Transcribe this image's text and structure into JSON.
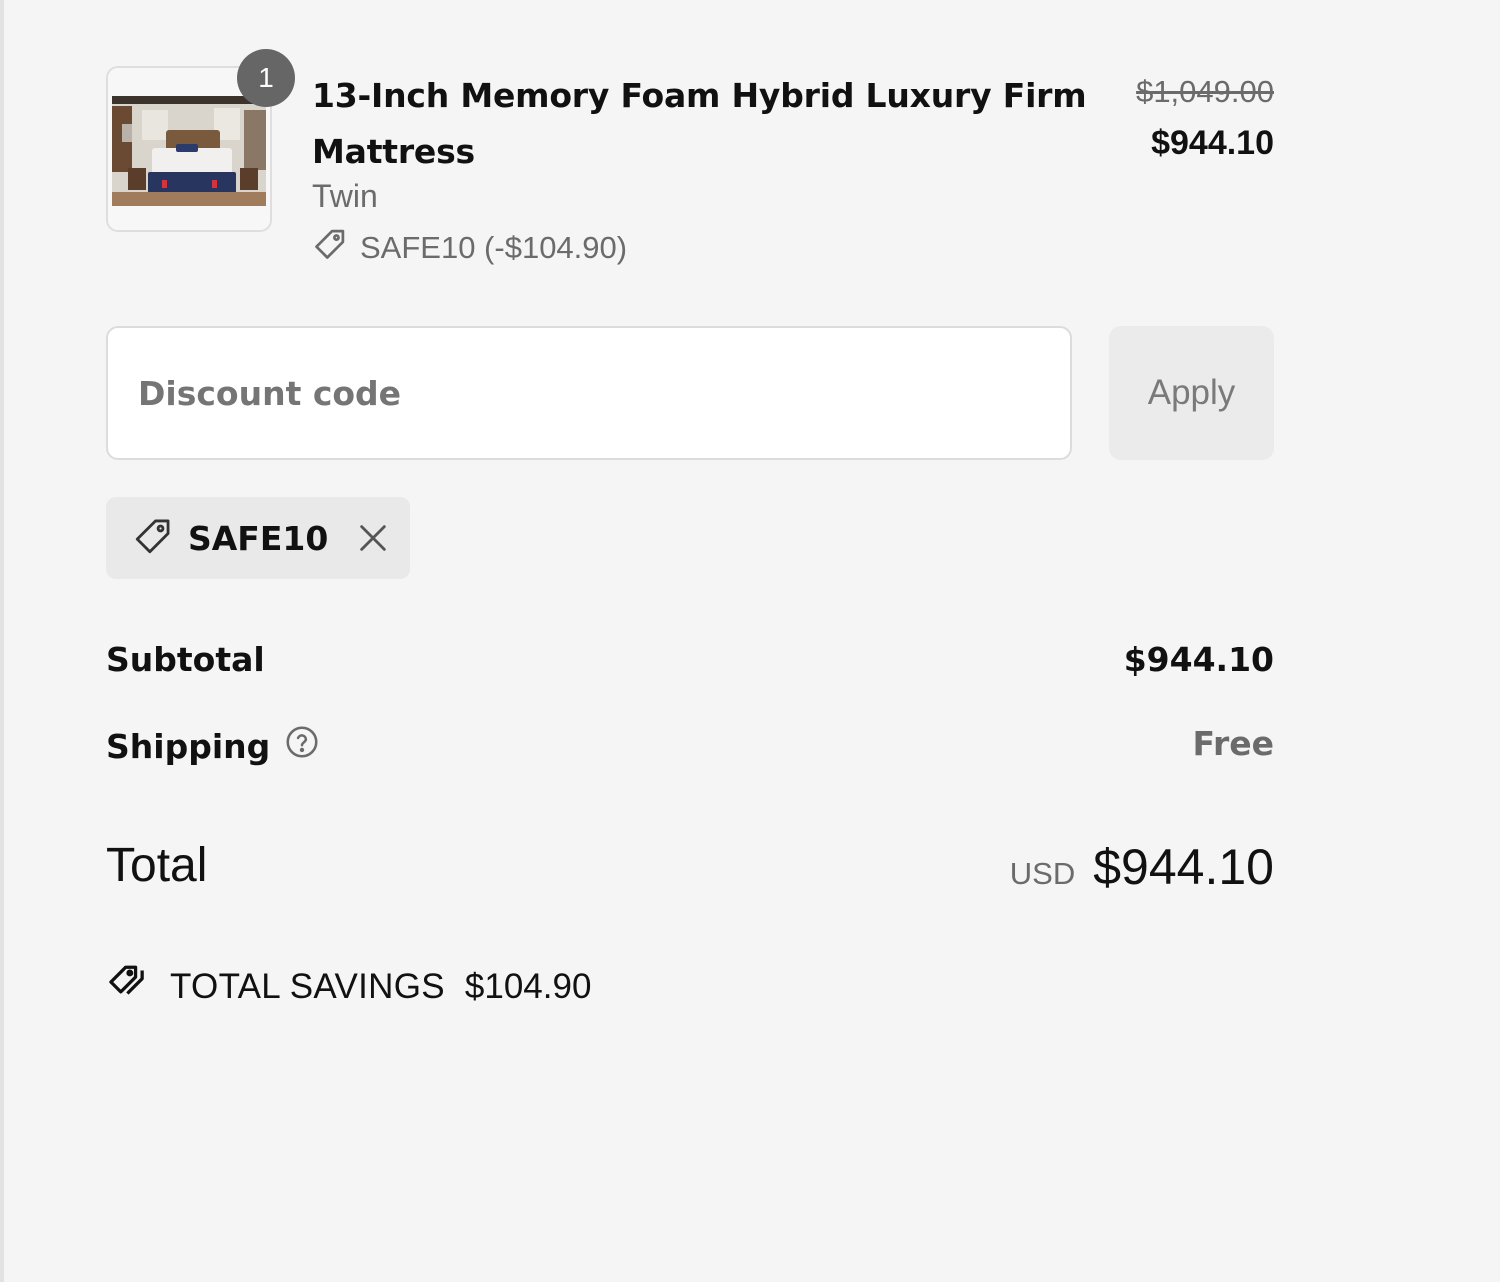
{
  "line_item": {
    "quantity": "1",
    "title": "13-Inch Memory Foam Hybrid Luxury Firm Mattress",
    "variant": "Twin",
    "discount_text": "SAFE10 (-$104.90)",
    "original_price": "$1,049.00",
    "sale_price": "$944.10",
    "image_icon": "bedroom-mattress-photo"
  },
  "discount_form": {
    "placeholder": "Discount code",
    "apply_label": "Apply"
  },
  "applied_code": {
    "code": "SAFE10",
    "icon": "tag-icon",
    "remove_icon": "close-icon"
  },
  "summary": {
    "subtotal_label": "Subtotal",
    "subtotal_value": "$944.10",
    "shipping_label": "Shipping",
    "shipping_value": "Free",
    "total_label": "Total",
    "currency": "USD",
    "total_value": "$944.10",
    "savings_label": "TOTAL SAVINGS",
    "savings_value": "$104.90"
  },
  "colors": {
    "background": "#f5f5f5",
    "muted_text": "#6b6b6b",
    "badge": "#666666",
    "chip": "#e9e9e9"
  }
}
